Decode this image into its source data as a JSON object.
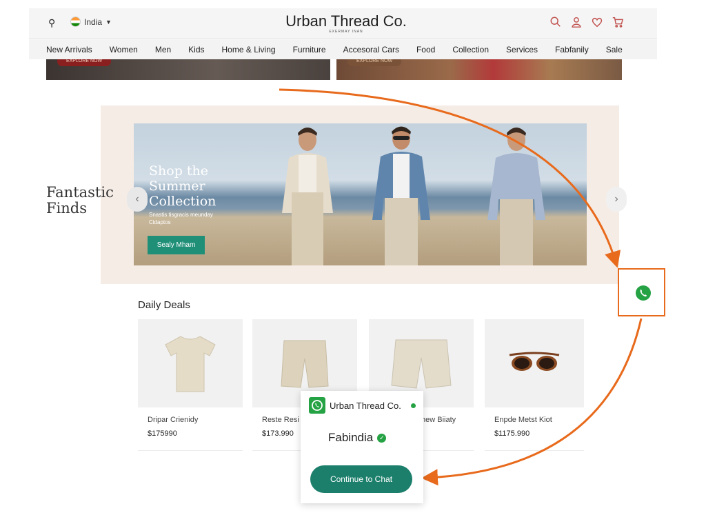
{
  "header": {
    "country": "India",
    "brand": "Urban Thread Co.",
    "brand_sub": "EXERMAY INAN"
  },
  "nav": {
    "items": [
      "New Arrivals",
      "Women",
      "Men",
      "Kids",
      "Home & Living",
      "Furniture",
      "Accesoral Cars",
      "Food",
      "Collection",
      "Services",
      "Fabfanily",
      "Sale"
    ]
  },
  "top_banners": {
    "left_button": "EXPLORE NOW",
    "right_button": "EXPLORE NOW"
  },
  "hero": {
    "side_title_line1": "Fantastic",
    "side_title_line2": "Finds",
    "title_line1": "Shop the",
    "title_line2": "Summer",
    "title_line3": "Collection",
    "subtitle_line1": "Snastis tisgracis meunday",
    "subtitle_line2": "Cidaptos",
    "cta": "Sealy Mham"
  },
  "deals": {
    "title": "Daily Deals",
    "items": [
      {
        "name": "Dripar Crienidy",
        "price": "$175990"
      },
      {
        "name": "Reste Resi",
        "price": "$173.990"
      },
      {
        "name": "hew Biiaty",
        "price": ""
      },
      {
        "name": "Enpde Metst Kiot",
        "price": "$1175.990"
      }
    ]
  },
  "popup": {
    "brand": "Urban Thread Co.",
    "title": "Fabindia",
    "button": "Continue to Chat"
  },
  "colors": {
    "accent_teal": "#1b7f6b",
    "whatsapp_green": "#25a244",
    "annotation_orange": "#e86a1c",
    "header_icon": "#c0504d"
  },
  "icons": [
    "location-pin-icon",
    "search-icon",
    "user-icon",
    "heart-icon",
    "cart-icon",
    "whatsapp-icon",
    "verified-icon",
    "chevron-left-icon",
    "chevron-right-icon"
  ]
}
